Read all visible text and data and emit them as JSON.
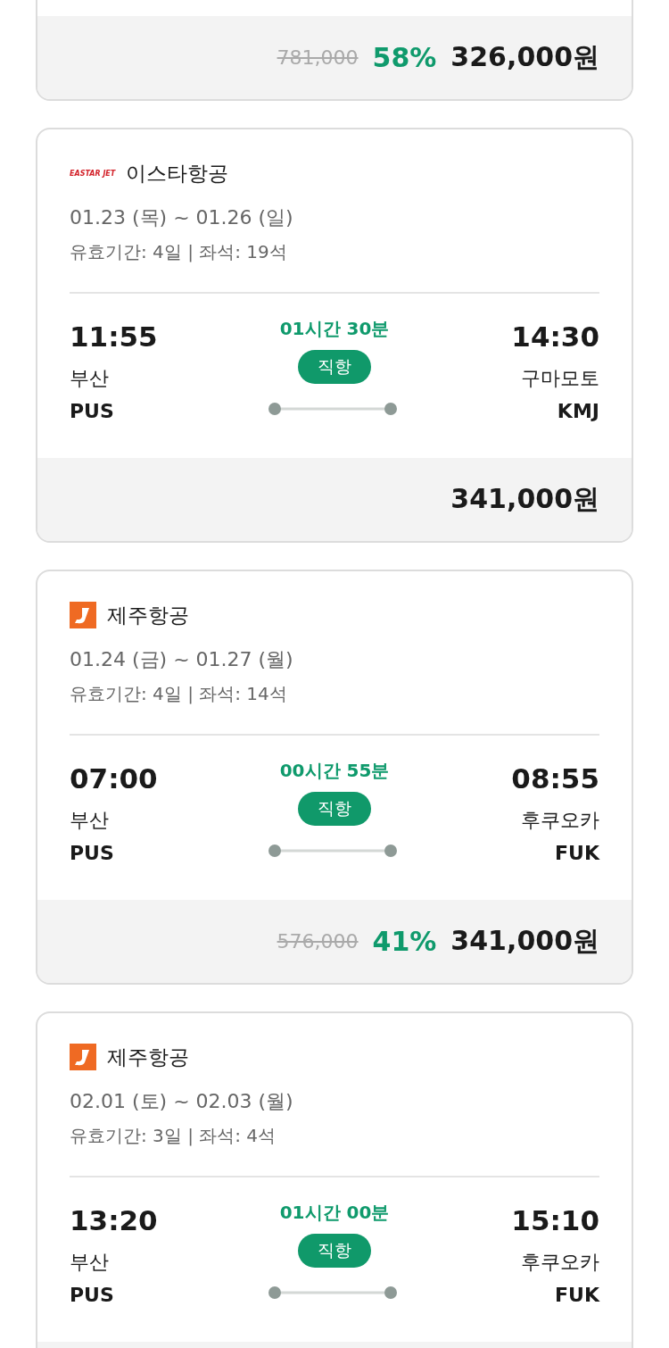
{
  "flights": [
    {
      "partial": true,
      "original_price": "781,000",
      "discount": "58%",
      "price": "326,000원"
    },
    {
      "logo": {
        "kind": "eastar",
        "text": "EASTAR JET"
      },
      "airline": "이스타항공",
      "dates": "01.23 (목) ~ 01.26 (일)",
      "validity": "유효기간: 4일 | 좌석: 19석",
      "dep_time": "11:55",
      "dep_city": "부산",
      "dep_code": "PUS",
      "duration": "01시간 30분",
      "type": "직항",
      "arr_time": "14:30",
      "arr_city": "구마모토",
      "arr_code": "KMJ",
      "price": "341,000원"
    },
    {
      "logo": {
        "kind": "jeju"
      },
      "airline": "제주항공",
      "dates": "01.24 (금) ~ 01.27 (월)",
      "validity": "유효기간: 4일 | 좌석: 14석",
      "dep_time": "07:00",
      "dep_city": "부산",
      "dep_code": "PUS",
      "duration": "00시간 55분",
      "type": "직항",
      "arr_time": "08:55",
      "arr_city": "후쿠오카",
      "arr_code": "FUK",
      "original_price": "576,000",
      "discount": "41%",
      "price": "341,000원"
    },
    {
      "logo": {
        "kind": "jeju"
      },
      "airline": "제주항공",
      "dates": "02.01 (토) ~ 02.03 (월)",
      "validity": "유효기간: 3일 | 좌석: 4석",
      "dep_time": "13:20",
      "dep_city": "부산",
      "dep_code": "PUS",
      "duration": "01시간 00분",
      "type": "직항",
      "arr_time": "15:10",
      "arr_city": "후쿠오카",
      "arr_code": "FUK"
    }
  ]
}
